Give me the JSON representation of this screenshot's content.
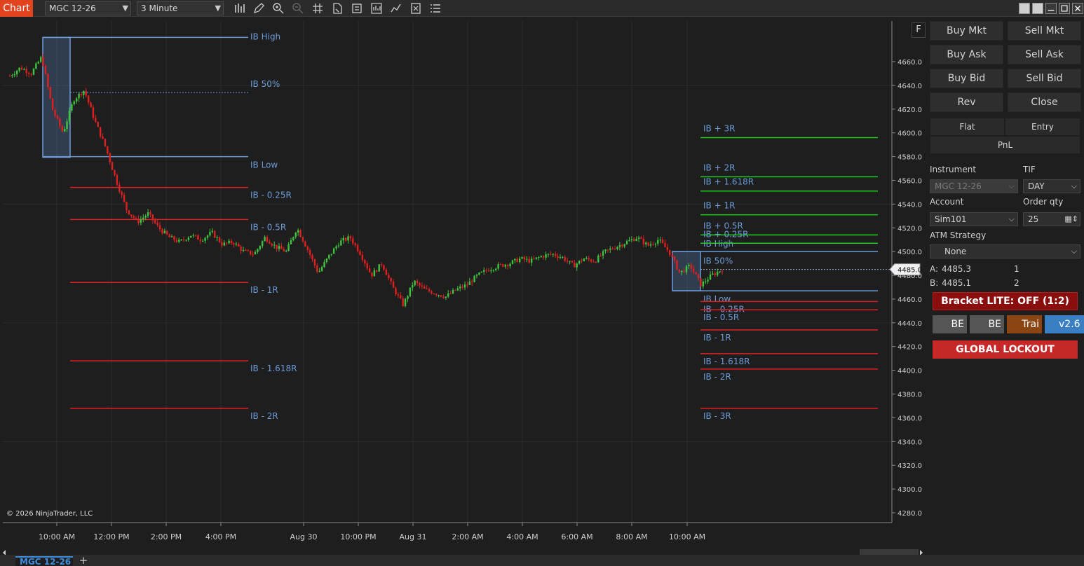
{
  "toolbar": {
    "chart_tab": "Chart",
    "instrument": "MGC 12-26",
    "interval": "3 Minute"
  },
  "chart": {
    "copyright": "© 2026 NinjaTrader, LLC",
    "f_button": "F",
    "current_price_label": "4485.0"
  },
  "chart_data": {
    "type": "candlestick",
    "y_ticks": [
      "4660.0",
      "4640.0",
      "4620.0",
      "4600.0",
      "4580.0",
      "4560.0",
      "4540.0",
      "4520.0",
      "4500.0",
      "4480.0",
      "4460.0",
      "4440.0",
      "4420.0",
      "4400.0",
      "4380.0",
      "4360.0",
      "4340.0",
      "4320.0",
      "4300.0",
      "4280.0"
    ],
    "x_ticks": [
      "10:00 AM",
      "12:00 PM",
      "2:00 PM",
      "4:00 PM",
      "Aug 30",
      "10:00 PM",
      "Aug 31",
      "2:00 AM",
      "4:00 AM",
      "6:00 AM",
      "8:00 AM",
      "10:00 AM"
    ],
    "ylim": [
      4275,
      4680
    ],
    "current_price": 4485.0,
    "ib_session_1": {
      "high": 4681,
      "mid": 4634,
      "low": 4580,
      "labels": {
        "high": "IB High",
        "mid": "IB 50%",
        "low": "IB Low",
        "down": [
          {
            "label": "IB - 0.25R",
            "price": 4554
          },
          {
            "label": "IB - 0.5R",
            "price": 4527
          },
          {
            "label": "IB - 1R",
            "price": 4474
          },
          {
            "label": "IB - 1.618R",
            "price": 4408
          },
          {
            "label": "IB - 2R",
            "price": 4368
          }
        ]
      }
    },
    "ib_session_2": {
      "high": 4500,
      "mid": 4485,
      "low": 4467,
      "labels": {
        "high": "IB High",
        "mid": "IB 50%",
        "low": "IB Low",
        "up": [
          {
            "label": "IB + 3R",
            "price": 4596
          },
          {
            "label": "IB + 2R",
            "price": 4563
          },
          {
            "label": "IB + 1.618R",
            "price": 4551
          },
          {
            "label": "IB + 1R",
            "price": 4531
          },
          {
            "label": "IB + 0.5R",
            "price": 4514
          },
          {
            "label": "IB + 0.25R",
            "price": 4507
          }
        ],
        "down": [
          {
            "label": "IB - 0.25R",
            "price": 4458
          },
          {
            "label": "IB - 0.5R",
            "price": 4451
          },
          {
            "label": "IB - 1R",
            "price": 4434
          },
          {
            "label": "IB - 1.618R",
            "price": 4414
          },
          {
            "label": "IB - 2R",
            "price": 4401
          },
          {
            "label": "IB - 3R",
            "price": 4368
          }
        ]
      }
    },
    "price_path": [
      4648,
      4655,
      4650,
      4664,
      4620,
      4600,
      4628,
      4636,
      4610,
      4588,
      4560,
      4535,
      4525,
      4532,
      4520,
      4512,
      4508,
      4514,
      4510,
      4516,
      4506,
      4508,
      4500,
      4498,
      4512,
      4504,
      4500,
      4520,
      4502,
      4482,
      4496,
      4508,
      4512,
      4498,
      4480,
      4490,
      4470,
      4455,
      4475,
      4468,
      4465,
      4462,
      4468,
      4472,
      4480,
      4485,
      4488,
      4490,
      4494,
      4492,
      4496,
      4498,
      4495,
      4488,
      4494,
      4492,
      4500,
      4504,
      4508,
      4512,
      4505,
      4510,
      4500,
      4482,
      4488,
      4472,
      4480,
      4485
    ]
  },
  "tabs": {
    "active": "MGC 12-26",
    "add": "+"
  },
  "panel": {
    "buy_mkt": "Buy Mkt",
    "sell_mkt": "Sell Mkt",
    "buy_ask": "Buy Ask",
    "sell_ask": "Sell Ask",
    "buy_bid": "Buy Bid",
    "sell_bid": "Sell Bid",
    "rev": "Rev",
    "close": "Close",
    "flat": "Flat",
    "entry": "Entry",
    "pnl": "PnL",
    "instrument_label": "Instrument",
    "instrument_value": "MGC 12-26",
    "tif_label": "TIF",
    "tif_value": "DAY",
    "account_label": "Account",
    "account_value": "Sim101",
    "order_qty_label": "Order qty",
    "order_qty_value": "25",
    "atm_label": "ATM Strategy",
    "atm_value": "None",
    "ask_label": "A:",
    "ask_price": "4485.3",
    "ask_size": "1",
    "bid_label": "B:",
    "bid_price": "4485.1",
    "bid_size": "2",
    "bracket": "Bracket LITE: OFF (1:2)",
    "be1": "BE",
    "be2": "BE",
    "trail": "Trai",
    "version": "v2.6",
    "lockout": "GLOBAL LOCKOUT"
  },
  "colors": {
    "up_candle": "#3fc43f",
    "down_candle": "#e02020",
    "ib_box": "#6c9bd8",
    "up_level": "#22cc22",
    "down_level": "#e02020",
    "accent": "#e0431d",
    "bracket": "#8b0e0e",
    "lockout": "#c62828"
  }
}
